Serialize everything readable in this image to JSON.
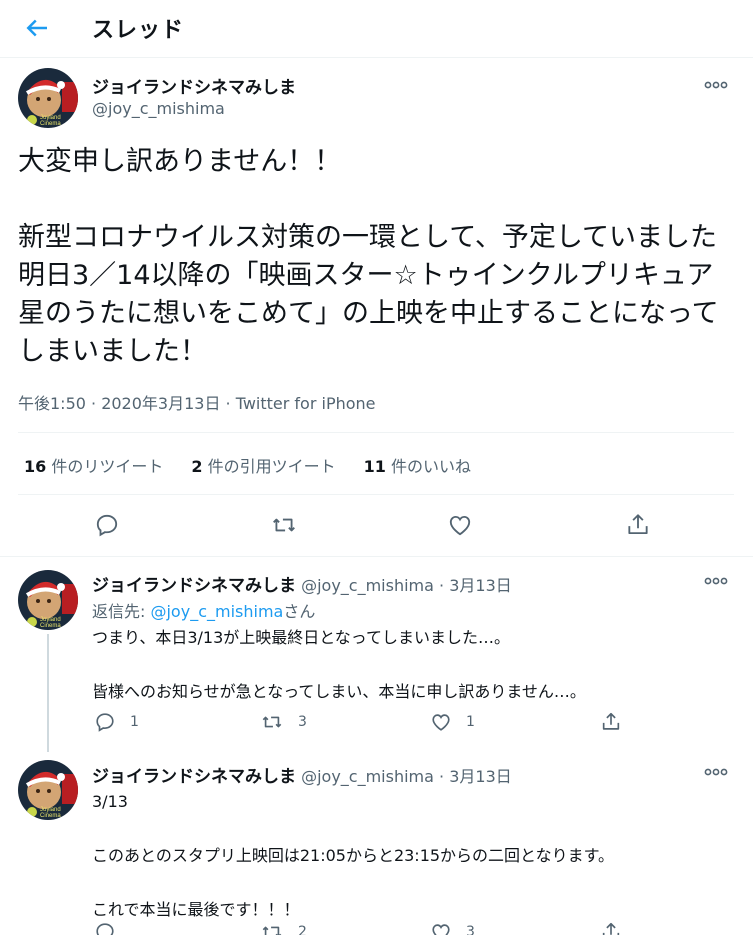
{
  "header": {
    "title": "スレッド"
  },
  "main_tweet": {
    "name": "ジョイランドシネマみしま",
    "handle": "@joy_c_mishima",
    "text": "大変申し訳ありません！！\n\n新型コロナウイルス対策の一環として、予定していました明日3／14以降の「映画スター☆トゥインクルプリキュア　星のうたに想いをこめて」の上映を中止することになってしまいました！",
    "meta": "午後1:50 · 2020年3月13日 · Twitter for iPhone",
    "retweets_count": "16",
    "retweets_label": "件のリツイート",
    "quotes_count": "2",
    "quotes_label": "件の引用ツイート",
    "likes_count": "11",
    "likes_label": "件のいいね"
  },
  "replies": [
    {
      "name": "ジョイランドシネマみしま",
      "handle": "@joy_c_mishima",
      "date": "3月13日",
      "reply_to_prefix": "返信先: ",
      "reply_to_handle": "@joy_c_mishima",
      "reply_to_suffix": "さん",
      "text": "つまり、本日3/13が上映最終日となってしまいました…。\n\n皆様へのお知らせが急となってしまい、本当に申し訳ありません…。",
      "reply_count": "1",
      "retweet_count": "3",
      "like_count": "1"
    },
    {
      "name": "ジョイランドシネマみしま",
      "handle": "@joy_c_mishima",
      "date": "3月13日",
      "text": "3/13\n\nこのあとのスタプリ上映回は21:05からと23:15からの二回となります。\n\nこれで本当に最後です！！！",
      "reply_count": "",
      "retweet_count": "2",
      "like_count": "3"
    }
  ],
  "separator": " · ",
  "avatar_text": "Joyland Cinema",
  "colors": {
    "accent": "#1d9bf0",
    "muted": "#536471",
    "text": "#0f1419",
    "border": "#eff3f4"
  }
}
